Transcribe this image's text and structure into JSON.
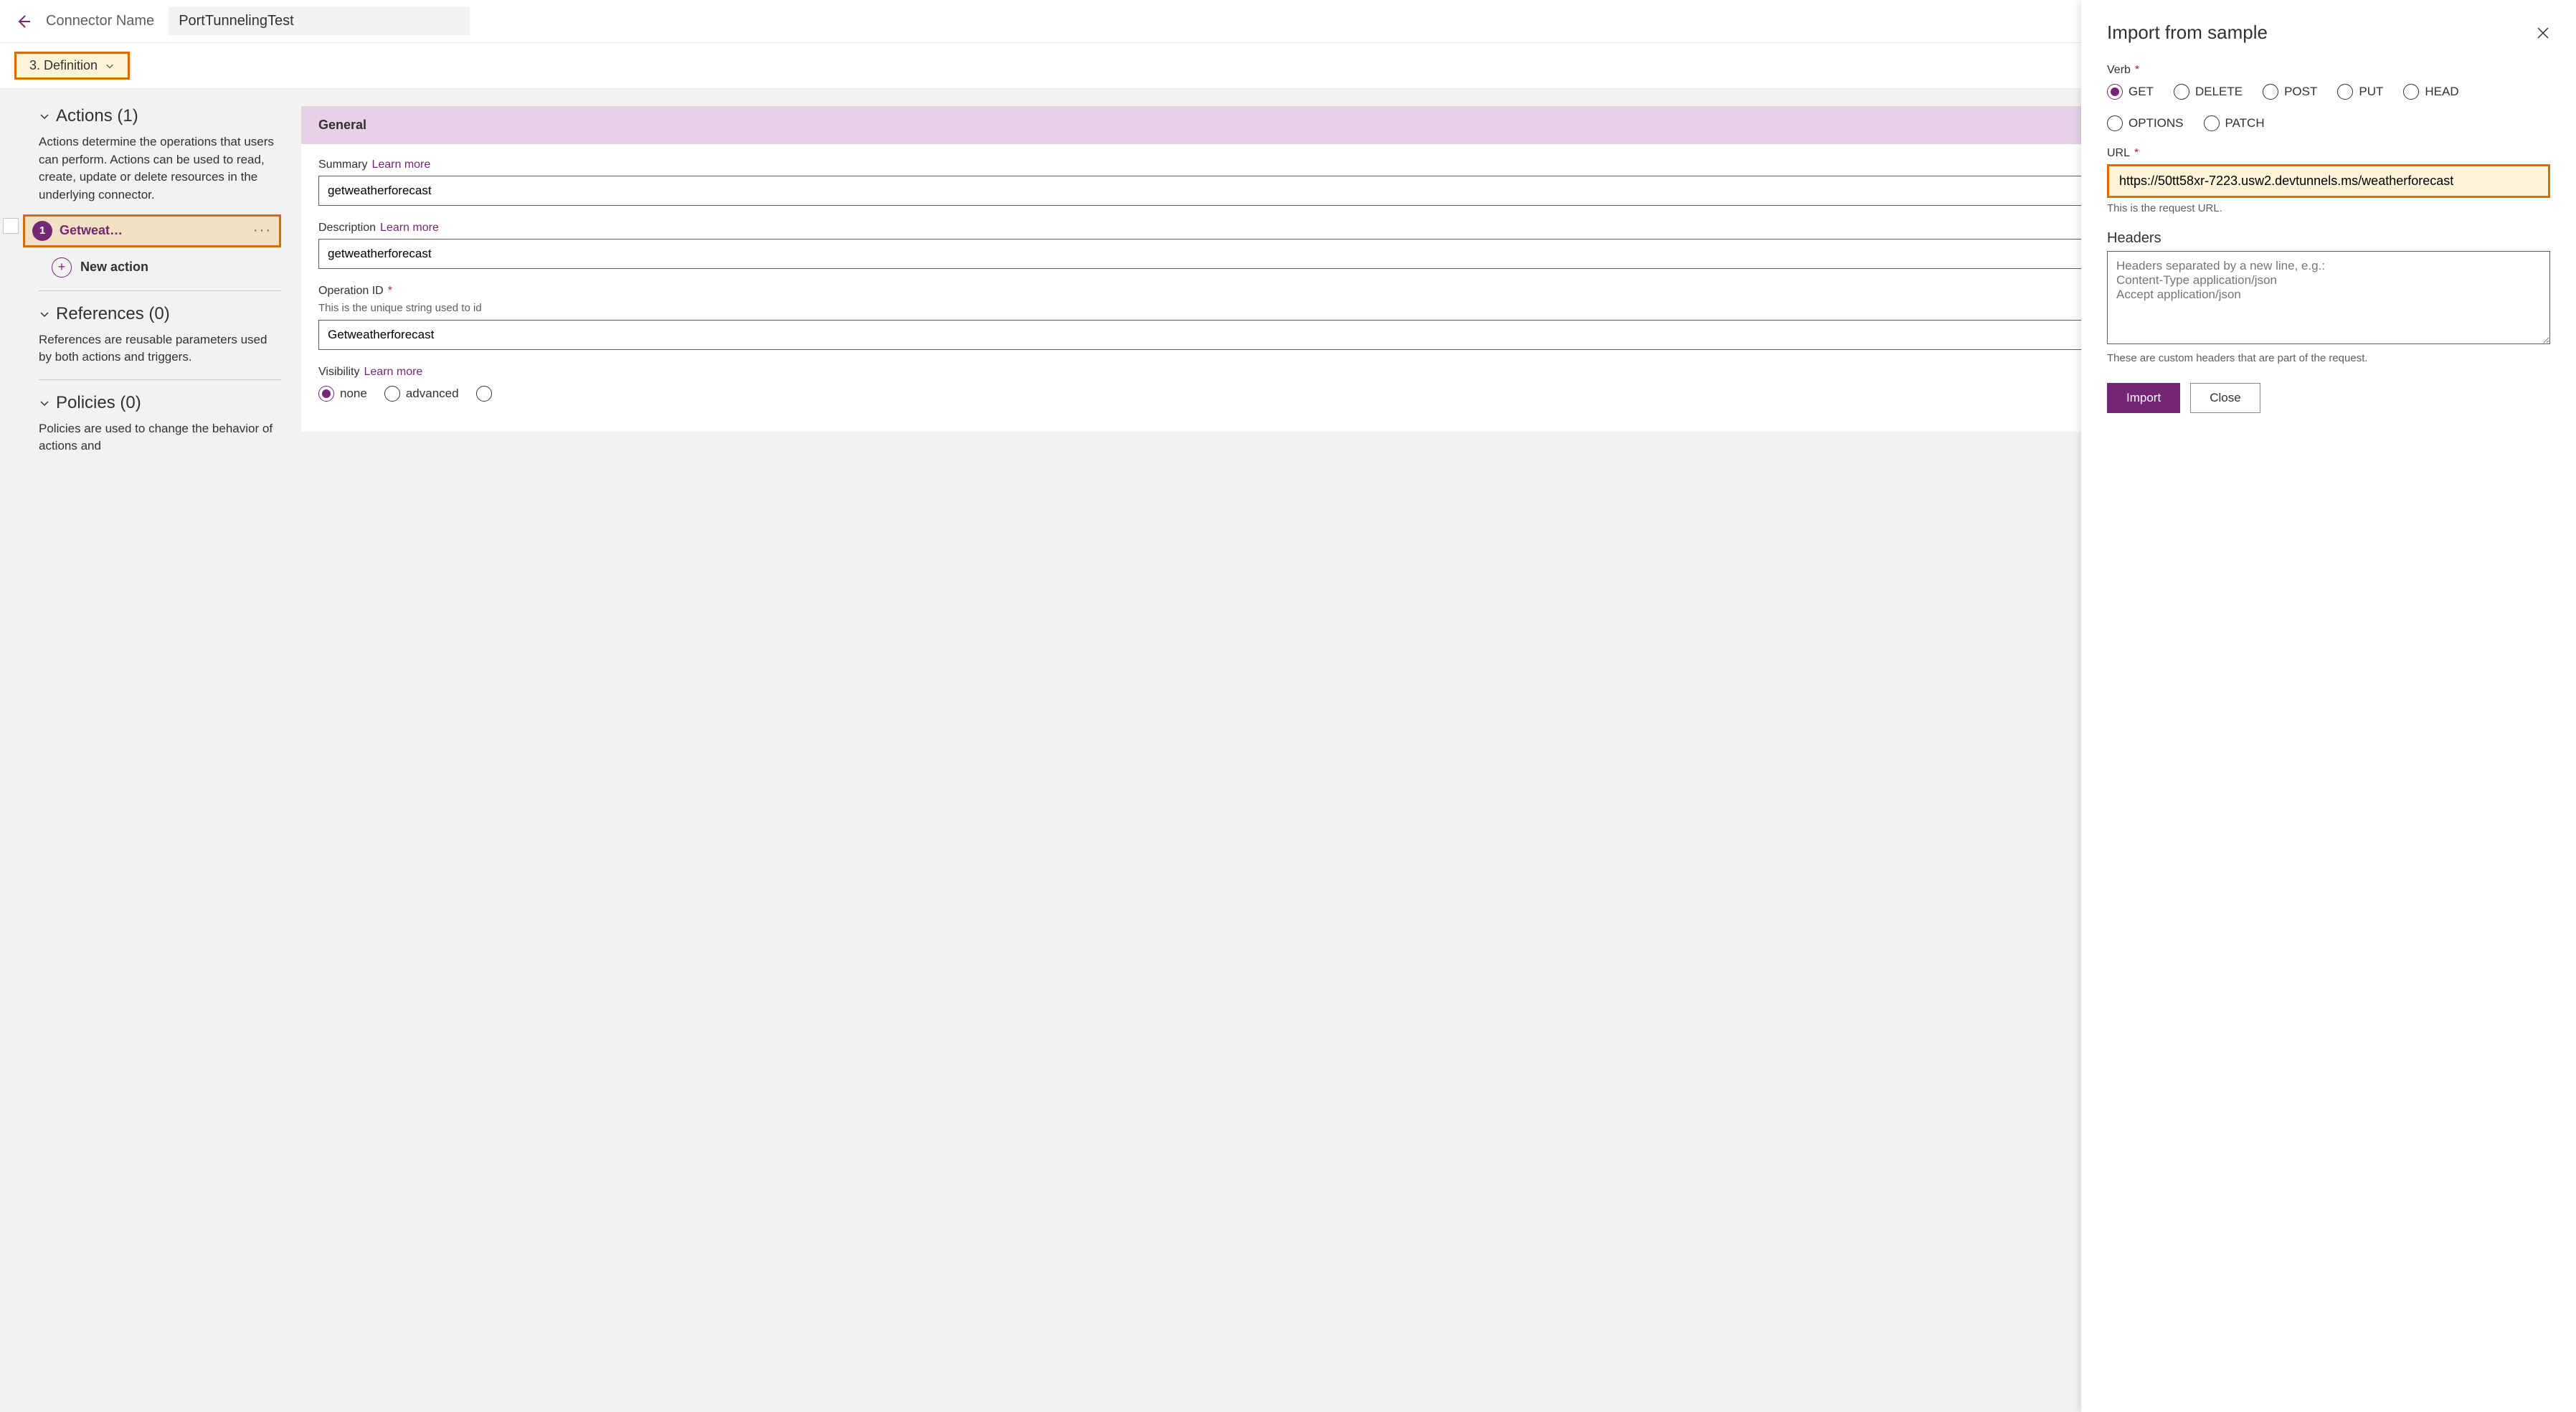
{
  "header": {
    "connector_name_label": "Connector Name",
    "connector_name_value": "PortTunnelingTest"
  },
  "step": {
    "label": "3. Definition"
  },
  "sections": {
    "actions": {
      "title": "Actions (1)",
      "description": "Actions determine the operations that users can perform. Actions can be used to read, create, update or delete resources in the underlying connector.",
      "items": [
        {
          "badge": "1",
          "label": "Getweat…"
        }
      ],
      "new_action_label": "New action"
    },
    "references": {
      "title": "References (0)",
      "description": "References are reusable parameters used by both actions and triggers."
    },
    "policies": {
      "title": "Policies (0)",
      "description": "Policies are used to change the behavior of actions and"
    }
  },
  "general": {
    "card_title": "General",
    "summary_label": "Summary",
    "summary_value": "getweatherforecast",
    "description_label": "Description",
    "description_value": "getweatherforecast",
    "operation_id_label": "Operation ID",
    "operation_id_help": "This is the unique string used to id",
    "operation_id_value": "Getweatherforecast",
    "visibility_label": "Visibility",
    "visibility_options": [
      "none",
      "advanced"
    ],
    "learn_more": "Learn more"
  },
  "side_panel": {
    "title": "Import from sample",
    "verb_label": "Verb",
    "verbs": [
      "GET",
      "DELETE",
      "POST",
      "PUT",
      "HEAD",
      "OPTIONS",
      "PATCH"
    ],
    "verb_selected": "GET",
    "url_label": "URL",
    "url_value": "https://50tt58xr-7223.usw2.devtunnels.ms/weatherforecast",
    "url_help": "This is the request URL.",
    "headers_label": "Headers",
    "headers_placeholder": "Headers separated by a new line, e.g.:\nContent-Type application/json\nAccept application/json",
    "headers_help": "These are custom headers that are part of the request.",
    "import_label": "Import",
    "close_label": "Close"
  }
}
